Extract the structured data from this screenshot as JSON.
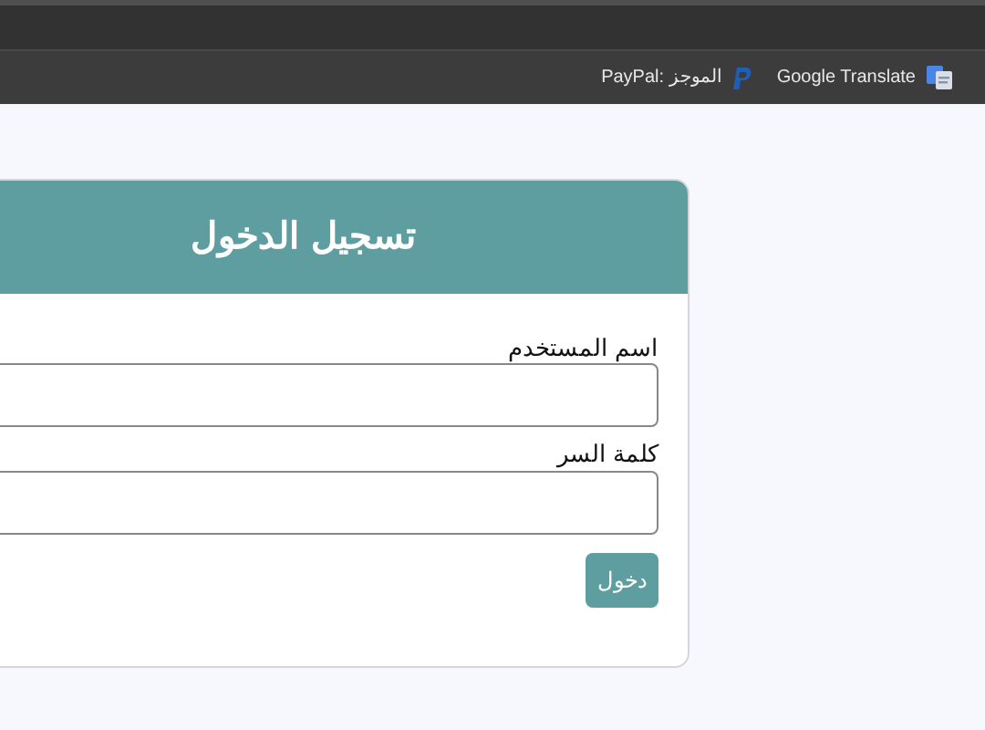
{
  "bookmarks": [
    {
      "label": "Google Translate",
      "kind": "translate"
    },
    {
      "label": "PayPal: الموجز",
      "kind": "paypal"
    }
  ],
  "login": {
    "title": "تسجيل الدخول",
    "fields": [
      {
        "label": "اسم المستخدم"
      },
      {
        "label": "كلمة السر"
      }
    ],
    "submit": "دخول"
  }
}
